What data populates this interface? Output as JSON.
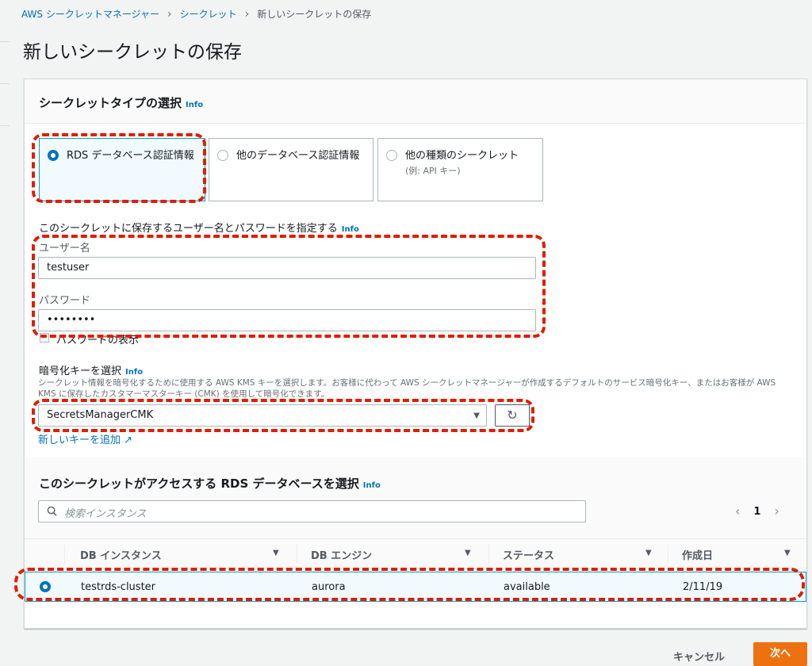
{
  "breadcrumb": {
    "items": [
      "AWS シークレットマネージャー",
      "シークレット"
    ],
    "current": "新しいシークレットの保存"
  },
  "page_title": "新しいシークレットの保存",
  "secret_type": {
    "heading": "シークレットタイプの選択",
    "info": "Info",
    "options": [
      {
        "label": "RDS データベース認証情報",
        "selected": true
      },
      {
        "label": "他のデータベース認証情報",
        "selected": false
      },
      {
        "label": "他の種類のシークレット",
        "sublabel": "(例: API キー)",
        "selected": false
      }
    ]
  },
  "credentials": {
    "heading": "このシークレットに保存するユーザー名とパスワードを指定する",
    "info": "Info",
    "username_label": "ユーザー名",
    "username_value": "testuser",
    "password_label": "パスワード",
    "password_value": "••••••••",
    "show_password_label": "パスワードの表示"
  },
  "encryption": {
    "heading": "暗号化キーを選択",
    "info": "Info",
    "description": "シークレット情報を暗号化するために使用する AWS KMS キーを選択します。お客様に代わって AWS シークレットマネージャーが作成するデフォルトのサービス暗号化キー、またはお客様が AWS KMS に保存したカスタマーマスターキー (CMK) を使用して暗号化できます。",
    "selected_key": "SecretsManagerCMK",
    "add_key_link": "新しいキーを追加"
  },
  "database": {
    "heading": "このシークレットがアクセスする RDS データベースを選択",
    "info": "Info",
    "search_placeholder": "検索インスタンス",
    "page": "1",
    "columns": [
      "DB インスタンス",
      "DB エンジン",
      "ステータス",
      "作成日"
    ],
    "rows": [
      {
        "instance": "testrds-cluster",
        "engine": "aurora",
        "status": "available",
        "created": "2/11/19",
        "selected": true
      }
    ]
  },
  "footer": {
    "cancel_label": "キャンセル",
    "next_label": "次へ"
  },
  "colors": {
    "annotation": "#e01d00",
    "primary_button": "#ec7211",
    "link": "#0073bb"
  }
}
